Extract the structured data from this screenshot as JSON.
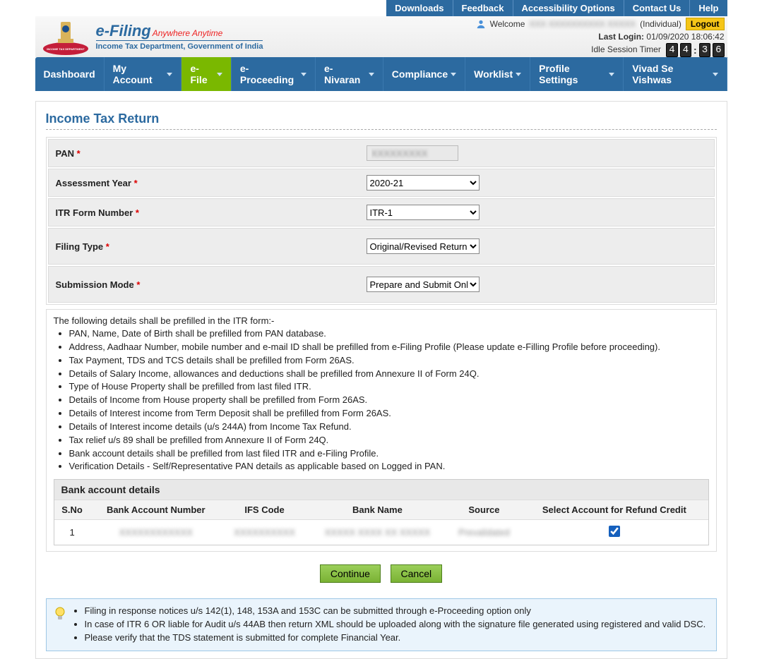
{
  "utilbar": [
    "Downloads",
    "Feedback",
    "Accessibility Options",
    "Contact Us",
    "Help"
  ],
  "brand": {
    "title": "e-Filing",
    "tagline": "Anywhere Anytime",
    "subtitle": "Income Tax Department, Government of India"
  },
  "user": {
    "welcome": "Welcome",
    "name_masked": "XXX XXXXXXXXXX XXXXX",
    "role": "(Individual)",
    "logout": "Logout",
    "last_login_label": "Last Login:",
    "last_login_value": "01/09/2020 18:06:42",
    "idle_label": "Idle Session Timer",
    "timer": [
      "4",
      "4",
      "3",
      "6"
    ]
  },
  "nav": [
    {
      "label": "Dashboard",
      "caret": false,
      "active": false
    },
    {
      "label": "My Account",
      "caret": true,
      "active": false
    },
    {
      "label": "e-File",
      "caret": true,
      "active": true
    },
    {
      "label": "e-Proceeding",
      "caret": true,
      "active": false
    },
    {
      "label": "e-Nivaran",
      "caret": true,
      "active": false
    },
    {
      "label": "Compliance",
      "caret": true,
      "active": false
    },
    {
      "label": "Worklist",
      "caret": true,
      "active": false
    },
    {
      "label": "Profile Settings",
      "caret": true,
      "active": false
    },
    {
      "label": "Vivad Se Vishwas",
      "caret": true,
      "active": false
    }
  ],
  "page_title": "Income Tax Return",
  "form": {
    "pan": {
      "label": "PAN",
      "value": "XXXXXXXXX"
    },
    "ay": {
      "label": "Assessment Year",
      "value": "2020-21"
    },
    "itr": {
      "label": "ITR Form Number",
      "value": "ITR-1"
    },
    "filing": {
      "label": "Filing Type",
      "value": "Original/Revised Return"
    },
    "mode": {
      "label": "Submission Mode",
      "value": "Prepare and Submit Online"
    }
  },
  "info_intro": "The following details shall be prefilled in the ITR form:-",
  "info_items": [
    "PAN, Name, Date of Birth shall be prefilled from PAN database.",
    "Address, Aadhaar Number, mobile number and e-mail ID shall be prefilled from e-Filing Profile (Please update e-Filling Profile before proceeding).",
    "Tax Payment, TDS and TCS details shall be prefilled from Form 26AS.",
    "Details of Salary Income, allowances and deductions shall be prefilled from Annexure II of Form 24Q.",
    "Type of House Property shall be prefilled from last filed ITR.",
    "Details of Income from House property shall be prefilled from Form 26AS.",
    "Details of Interest income from Term Deposit shall be prefilled from Form 26AS.",
    "Details of Interest income details (u/s 244A) from Income Tax Refund.",
    "Tax relief u/s 89 shall be prefilled from Annexure II of Form 24Q.",
    "Bank account details shall be prefilled from last filed ITR and e-Filing Profile.",
    "Verification Details - Self/Representative PAN details as applicable based on Logged in PAN."
  ],
  "bank": {
    "heading": "Bank account details",
    "cols": [
      "S.No",
      "Bank Account Number",
      "IFS Code",
      "Bank Name",
      "Source",
      "Select Account for Refund Credit"
    ],
    "rows": [
      {
        "sno": "1",
        "acct": "XXXXXXXXXXXX",
        "ifsc": "XXXXXXXXXX",
        "bank": "XXXXX XXXX XX XXXXX",
        "source": "Prevalidated",
        "selected": true
      }
    ]
  },
  "actions": {
    "continue": "Continue",
    "cancel": "Cancel"
  },
  "tips": [
    "Filing in response notices u/s 142(1), 148, 153A and 153C can be submitted through e-Proceeding option only",
    "In case of ITR 6 OR liable for Audit u/s 44AB then return XML should be uploaded along with the signature file generated using registered and valid DSC.",
    "Please verify that the TDS statement is submitted for complete Financial Year."
  ]
}
